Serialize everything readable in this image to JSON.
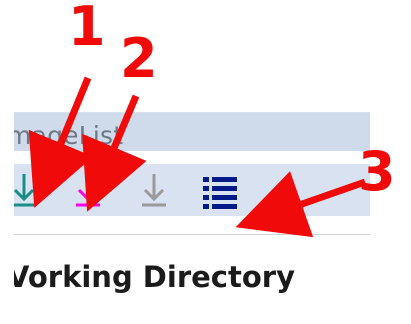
{
  "panel": {
    "title": "mageList",
    "section_title": "Vorking Directory"
  },
  "toolbar": {
    "buttons": [
      {
        "name": "download-teal",
        "color": "#1b8d87"
      },
      {
        "name": "download-magenta",
        "color": "#ff00e6"
      },
      {
        "name": "download-gray",
        "color": "#9a9a9a"
      },
      {
        "name": "list",
        "color": "#001a8a"
      }
    ]
  },
  "callouts": {
    "labels": [
      "1",
      "2",
      "3"
    ],
    "color": "#f10a0a"
  }
}
